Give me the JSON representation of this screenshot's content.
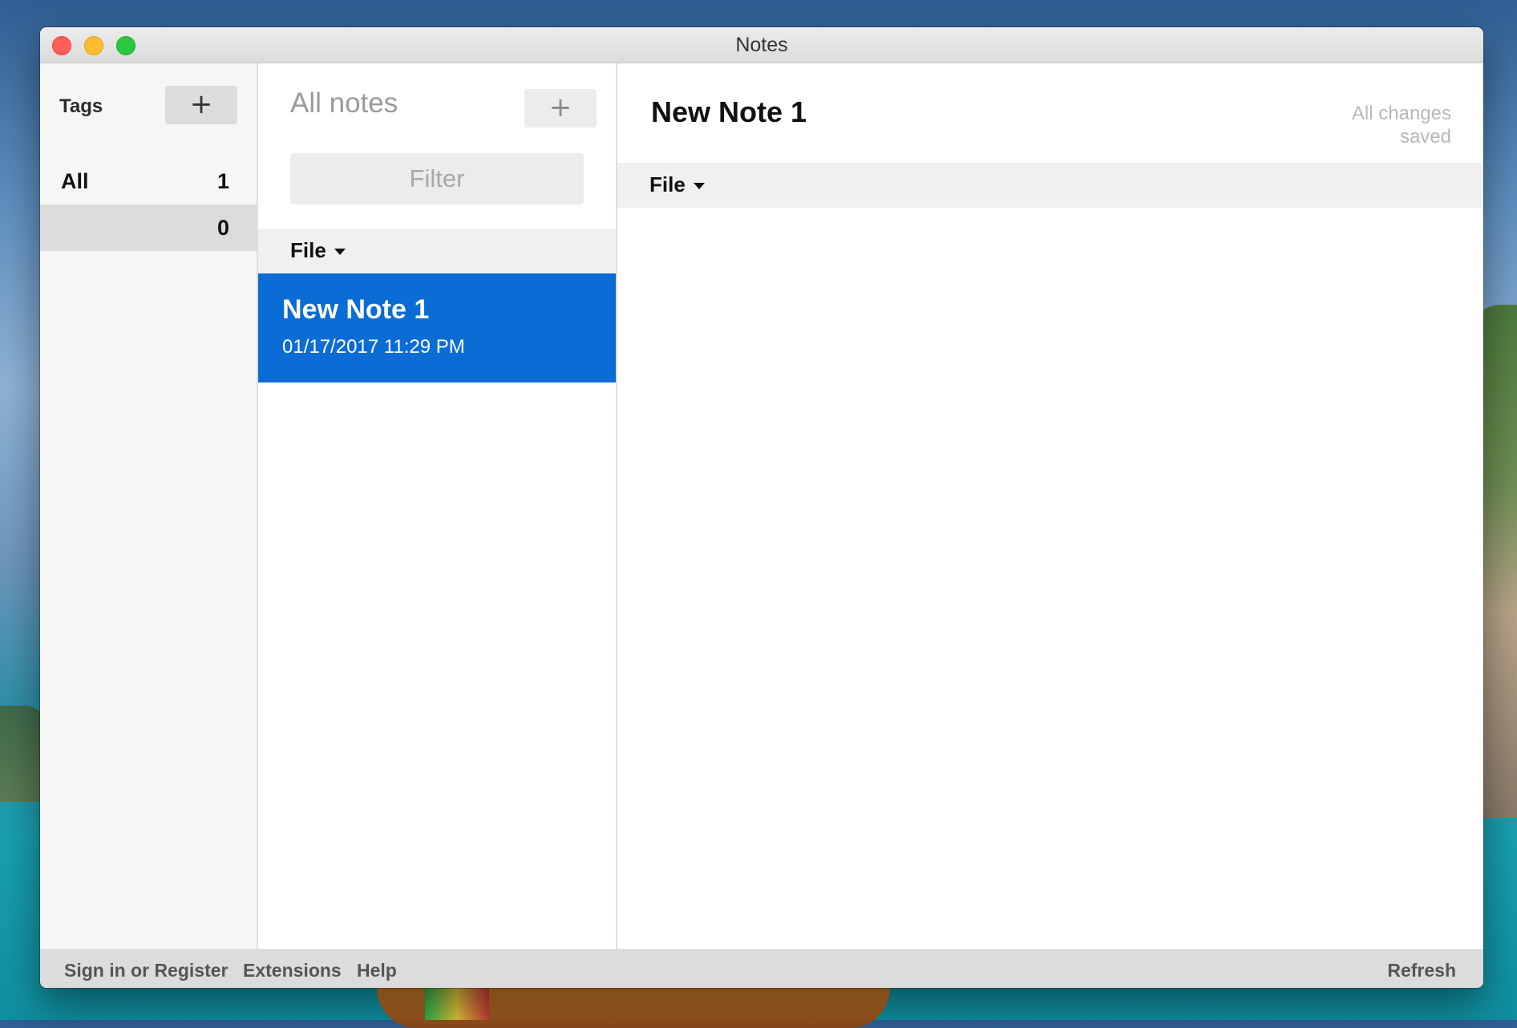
{
  "window": {
    "title": "Notes"
  },
  "tags": {
    "header": "Tags",
    "add_label": "+",
    "items": [
      {
        "label": "All",
        "count": "1"
      },
      {
        "label": "",
        "count": "0"
      }
    ]
  },
  "notes": {
    "header": "All notes",
    "add_label": "+",
    "filter_placeholder": "Filter",
    "menu_file": "File",
    "items": [
      {
        "title": "New Note 1",
        "date": "01/17/2017 11:29 PM",
        "selected": true
      }
    ]
  },
  "editor": {
    "title": "New Note 1",
    "status_line1": "All changes",
    "status_line2": "saved",
    "menu_file": "File"
  },
  "footer": {
    "signin": "Sign in or Register",
    "extensions": "Extensions",
    "help": "Help",
    "refresh": "Refresh"
  },
  "colors": {
    "accent": "#0b6cd6",
    "sidebar_bg": "#f6f6f6",
    "footer_bg": "#dcdcdc"
  }
}
